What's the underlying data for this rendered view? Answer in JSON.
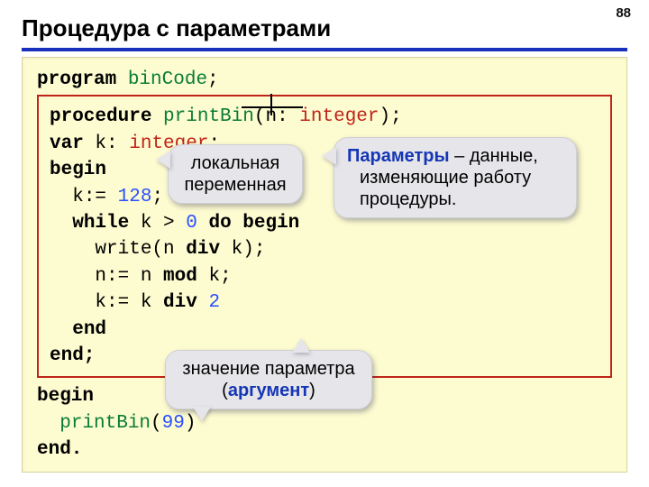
{
  "page_number": "88",
  "title": "Процедура с параметрами",
  "code": {
    "program_kw": "program",
    "program_name": "binCode",
    "semi": ";",
    "proc_kw": "procedure",
    "proc_name": "printBin",
    "lp": "(",
    "param_n": "n: ",
    "int_ty": "integer",
    "rp": ");",
    "var_kw": "var",
    "var_k": " k: ",
    "begin_kw": "begin",
    "kassign": "k:= ",
    "num128": "128",
    "while_kw": "while",
    "while_cond_a": " k > ",
    "zero": "0",
    "do_begin": " do begin",
    "write_l": "write(n ",
    "div_kw": "div",
    "write_r": " k);",
    "nassign_l": "n:= n ",
    "mod_kw": "mod",
    "nassign_r": " k;",
    "kdiv_l": "k:= k ",
    "kdiv_r": " ",
    "two": "2",
    "end_kw": "end",
    "endp": "end;",
    "begin2": "begin",
    "call_name": "printBin",
    "call_lp": "(",
    "call_arg": "99",
    "call_rp": ")",
    "enddot": "end."
  },
  "callouts": {
    "local_var_l1": "локальная",
    "local_var_l2": "переменная",
    "params_l1a": "Параметры",
    "params_l1b": " – данные,",
    "params_l2": "изменяющие работу",
    "params_l3": "процедуры.",
    "argval_l1": "значение параметра",
    "argval_l2a": "(",
    "argval_l2b": "аргумент",
    "argval_l2c": ")"
  }
}
